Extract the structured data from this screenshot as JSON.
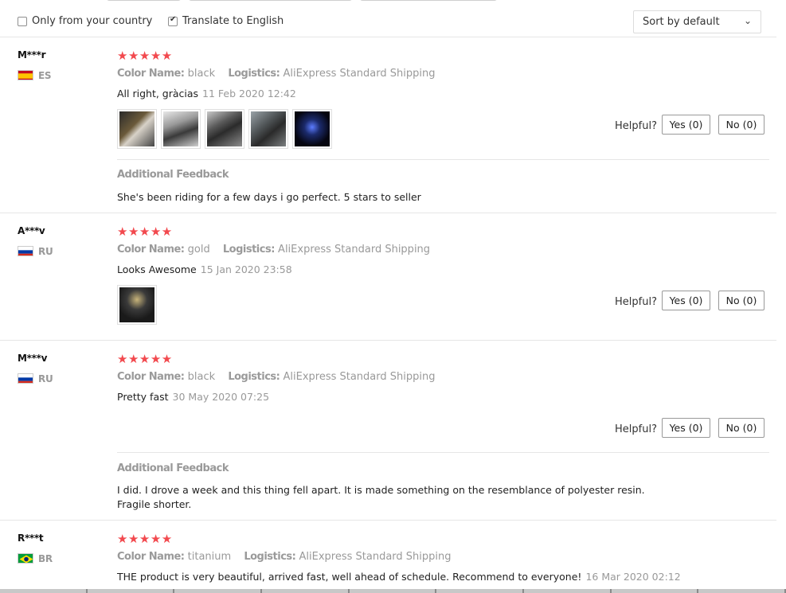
{
  "filters": {
    "only_country_label": "Only from your country",
    "only_country_checked": false,
    "translate_label": "Translate to English",
    "translate_checked": true,
    "sort_label": "Sort by default",
    "sort_chevron": "⌄"
  },
  "labels": {
    "color_name": "Color Name:",
    "logistics": "Logistics:",
    "helpful": "Helpful?",
    "additional_feedback": "Additional Feedback",
    "stars": "★★★★★"
  },
  "reviews": [
    {
      "user": "M***r",
      "country": "ES",
      "rating": 5,
      "color": "black",
      "logistics": "AliExpress Standard Shipping",
      "text": "All right, gràcias",
      "date": "11 Feb 2020 12:42",
      "photo_count": 5,
      "yes": "Yes (0)",
      "no": "No (0)",
      "feedback": "She's been riding for a few days i go perfect. 5 stars to seller"
    },
    {
      "user": "A***v",
      "country": "RU",
      "rating": 5,
      "color": "gold",
      "logistics": "AliExpress Standard Shipping",
      "text": "Looks Awesome",
      "date": "15 Jan 2020 23:58",
      "photo_count": 1,
      "yes": "Yes (0)",
      "no": "No (0)"
    },
    {
      "user": "M***v",
      "country": "RU",
      "rating": 5,
      "color": "black",
      "logistics": "AliExpress Standard Shipping",
      "text": "Pretty fast",
      "date": "30 May 2020 07:25",
      "yes": "Yes (0)",
      "no": "No (0)",
      "feedback": "I did. I drove a week and this thing fell apart. It is made something on the resemblance of polyester resin. Fragile shorter."
    },
    {
      "user": "R***t",
      "country": "BR",
      "rating": 5,
      "color": "titanium",
      "logistics": "AliExpress Standard Shipping",
      "text": "THE product is very beautiful, arrived fast, well ahead of schedule. Recommend to everyone!",
      "date": "16 Mar 2020 02:12"
    }
  ],
  "colors": {
    "star": "#f2494e",
    "muted": "#999999",
    "divider": "#e6e6e6"
  }
}
